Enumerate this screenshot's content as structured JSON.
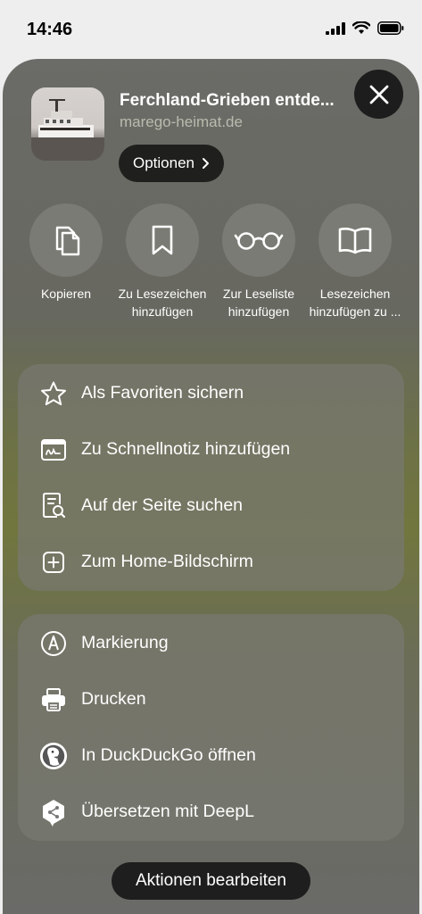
{
  "status": {
    "time": "14:46"
  },
  "header": {
    "title": "Ferchland-Grieben entde...",
    "domain": "marego-heimat.de",
    "options_label": "Optionen"
  },
  "actions": [
    {
      "label": "Kopieren",
      "icon": "copy-icon"
    },
    {
      "label": "Zu Lesezeichen hinzufügen",
      "icon": "bookmark-icon"
    },
    {
      "label": "Zur Leseliste hinzufügen",
      "icon": "glasses-icon"
    },
    {
      "label": "Lesezeichen hinzufügen zu ...",
      "icon": "book-icon"
    }
  ],
  "menu1": [
    {
      "label": "Als Favoriten sichern",
      "icon": "star-icon"
    },
    {
      "label": "Zu Schnellnotiz hinzufügen",
      "icon": "quicknote-icon"
    },
    {
      "label": "Auf der Seite suchen",
      "icon": "find-on-page-icon"
    },
    {
      "label": "Zum Home-Bildschirm",
      "icon": "add-square-icon"
    }
  ],
  "menu2": [
    {
      "label": "Markierung",
      "icon": "markup-icon"
    },
    {
      "label": "Drucken",
      "icon": "printer-icon"
    },
    {
      "label": "In DuckDuckGo öffnen",
      "icon": "duckduckgo-icon"
    },
    {
      "label": "Übersetzen mit DeepL",
      "icon": "deepl-icon"
    }
  ],
  "footer": {
    "edit_label": "Aktionen bearbeiten"
  }
}
